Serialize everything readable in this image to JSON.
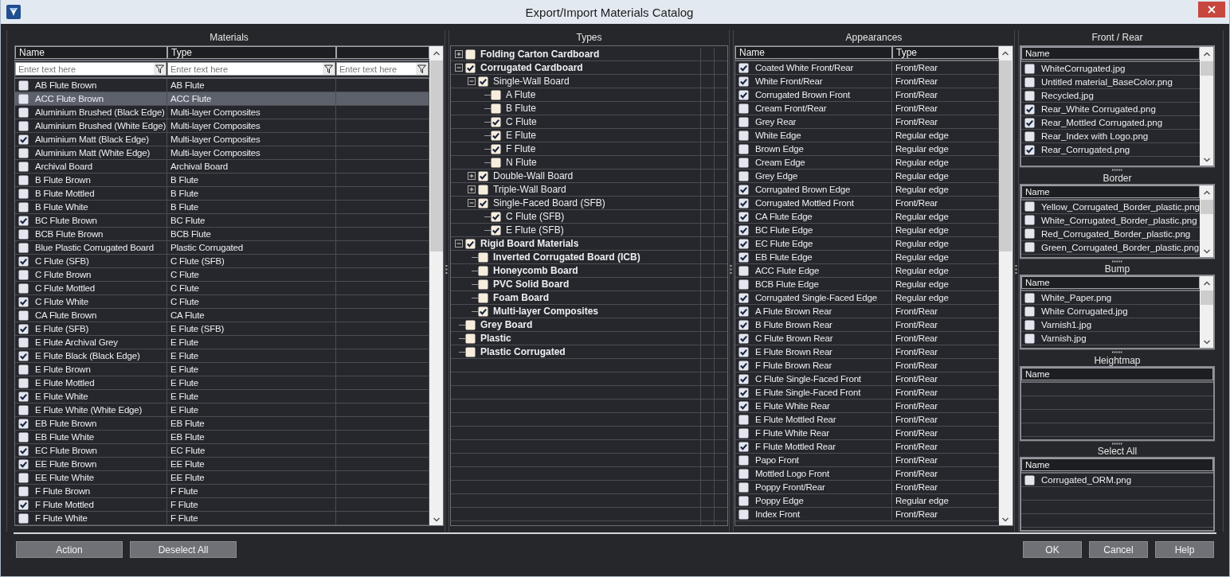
{
  "window": {
    "title": "Export/Import Materials Catalog"
  },
  "materials": {
    "title": "Materials",
    "columns": [
      {
        "label": "Name",
        "placeholder": "Enter text here"
      },
      {
        "label": "Type",
        "placeholder": "Enter text here"
      },
      {
        "placeholder": "Enter text here"
      }
    ],
    "rows": [
      {
        "name": "AB Flute Brown",
        "type": "AB Flute",
        "checked": false,
        "selected": false
      },
      {
        "name": "ACC Flute Brown",
        "type": "ACC Flute",
        "checked": false,
        "selected": true
      },
      {
        "name": "Aluminium Brushed (Black Edge)",
        "type": "Multi-layer Composites",
        "checked": false,
        "selected": false
      },
      {
        "name": "Aluminium Brushed (White Edge)",
        "type": "Multi-layer Composites",
        "checked": false,
        "selected": false
      },
      {
        "name": "Aluminium Matt (Black Edge)",
        "type": "Multi-layer Composites",
        "checked": true,
        "selected": false
      },
      {
        "name": "Aluminium Matt (White Edge)",
        "type": "Multi-layer Composites",
        "checked": false,
        "selected": false
      },
      {
        "name": "Archival Board",
        "type": "Archival Board",
        "checked": false,
        "selected": false
      },
      {
        "name": "B Flute Brown",
        "type": "B Flute",
        "checked": false,
        "selected": false
      },
      {
        "name": "B Flute Mottled",
        "type": "B Flute",
        "checked": false,
        "selected": false
      },
      {
        "name": "B Flute White",
        "type": "B Flute",
        "checked": false,
        "selected": false
      },
      {
        "name": "BC Flute Brown",
        "type": "BC Flute",
        "checked": true,
        "selected": false
      },
      {
        "name": "BCB Flute Brown",
        "type": "BCB Flute",
        "checked": false,
        "selected": false
      },
      {
        "name": "Blue Plastic Corrugated Board",
        "type": "Plastic Corrugated",
        "checked": false,
        "selected": false
      },
      {
        "name": "C Flute (SFB)",
        "type": "C Flute (SFB)",
        "checked": true,
        "selected": false
      },
      {
        "name": "C Flute Brown",
        "type": "C Flute",
        "checked": false,
        "selected": false
      },
      {
        "name": "C Flute Mottled",
        "type": "C Flute",
        "checked": false,
        "selected": false
      },
      {
        "name": "C Flute White",
        "type": "C Flute",
        "checked": true,
        "selected": false
      },
      {
        "name": "CA Flute Brown",
        "type": "CA Flute",
        "checked": false,
        "selected": false
      },
      {
        "name": "E Flute (SFB)",
        "type": "E Flute (SFB)",
        "checked": true,
        "selected": false
      },
      {
        "name": "E Flute Archival Grey",
        "type": "E Flute",
        "checked": false,
        "selected": false
      },
      {
        "name": "E Flute Black (Black Edge)",
        "type": "E Flute",
        "checked": true,
        "selected": false
      },
      {
        "name": "E Flute Brown",
        "type": "E Flute",
        "checked": false,
        "selected": false
      },
      {
        "name": "E Flute Mottled",
        "type": "E Flute",
        "checked": false,
        "selected": false
      },
      {
        "name": "E Flute White",
        "type": "E Flute",
        "checked": true,
        "selected": false
      },
      {
        "name": "E Flute White (White Edge)",
        "type": "E Flute",
        "checked": false,
        "selected": false
      },
      {
        "name": "EB Flute Brown",
        "type": "EB Flute",
        "checked": true,
        "selected": false
      },
      {
        "name": "EB Flute White",
        "type": "EB Flute",
        "checked": false,
        "selected": false
      },
      {
        "name": "EC Flute Brown",
        "type": "EC Flute",
        "checked": true,
        "selected": false
      },
      {
        "name": "EE Flute Brown",
        "type": "EE Flute",
        "checked": true,
        "selected": false
      },
      {
        "name": "EE Flute White",
        "type": "EE Flute",
        "checked": false,
        "selected": false
      },
      {
        "name": "F Flute Brown",
        "type": "F Flute",
        "checked": false,
        "selected": false
      },
      {
        "name": "F Flute Mottled",
        "type": "F Flute",
        "checked": true,
        "selected": false
      },
      {
        "name": "F Flute White",
        "type": "F Flute",
        "checked": false,
        "selected": false
      }
    ]
  },
  "types": {
    "title": "Types",
    "tree": [
      {
        "label": "Folding Carton Cardboard",
        "bold": true,
        "checked": false,
        "expanded": false
      },
      {
        "label": "Corrugated Cardboard",
        "bold": true,
        "checked": true,
        "expanded": true,
        "children": [
          {
            "label": "Single-Wall Board",
            "bold": false,
            "checked": true,
            "expanded": true,
            "children": [
              {
                "label": "A Flute",
                "bold": false,
                "checked": false
              },
              {
                "label": "B Flute",
                "bold": false,
                "checked": false
              },
              {
                "label": "C Flute",
                "bold": false,
                "checked": true
              },
              {
                "label": "E Flute",
                "bold": false,
                "checked": true
              },
              {
                "label": "F Flute",
                "bold": false,
                "checked": true
              },
              {
                "label": "N Flute",
                "bold": false,
                "checked": false
              }
            ]
          },
          {
            "label": "Double-Wall Board",
            "bold": false,
            "checked": true,
            "expanded": false
          },
          {
            "label": "Triple-Wall Board",
            "bold": false,
            "checked": false,
            "expanded": false
          },
          {
            "label": "Single-Faced Board (SFB)",
            "bold": false,
            "checked": true,
            "expanded": true,
            "children": [
              {
                "label": "C Flute (SFB)",
                "bold": false,
                "checked": true
              },
              {
                "label": "E Flute (SFB)",
                "bold": false,
                "checked": true
              }
            ]
          }
        ]
      },
      {
        "label": "Rigid Board Materials",
        "bold": true,
        "checked": true,
        "expanded": true,
        "children": [
          {
            "label": "Inverted Corrugated Board (ICB)",
            "bold": true,
            "checked": false
          },
          {
            "label": "Honeycomb Board",
            "bold": true,
            "checked": false
          },
          {
            "label": "PVC Solid Board",
            "bold": true,
            "checked": false
          },
          {
            "label": "Foam Board",
            "bold": true,
            "checked": false
          },
          {
            "label": "Multi-layer Composites",
            "bold": true,
            "checked": true
          }
        ]
      },
      {
        "label": "Grey Board",
        "bold": true,
        "checked": false
      },
      {
        "label": "Plastic",
        "bold": true,
        "checked": false
      },
      {
        "label": "Plastic Corrugated",
        "bold": true,
        "checked": false
      }
    ]
  },
  "appearances": {
    "title": "Appearances",
    "columns": [
      "Name",
      "Type"
    ],
    "rows": [
      {
        "name": "Coated White Front/Rear",
        "type": "Front/Rear",
        "checked": true
      },
      {
        "name": "White Front/Rear",
        "type": "Front/Rear",
        "checked": true
      },
      {
        "name": "Corrugated Brown Front",
        "type": "Front/Rear",
        "checked": true
      },
      {
        "name": "Cream Front/Rear",
        "type": "Front/Rear",
        "checked": false
      },
      {
        "name": "Grey Rear",
        "type": "Front/Rear",
        "checked": false
      },
      {
        "name": "White Edge",
        "type": "Regular edge",
        "checked": false
      },
      {
        "name": "Brown Edge",
        "type": "Regular edge",
        "checked": false
      },
      {
        "name": "Cream Edge",
        "type": "Regular edge",
        "checked": false
      },
      {
        "name": "Grey Edge",
        "type": "Regular edge",
        "checked": false
      },
      {
        "name": "Corrugated Brown Edge",
        "type": "Regular edge",
        "checked": true
      },
      {
        "name": "Corrugated Mottled Front",
        "type": "Front/Rear",
        "checked": true
      },
      {
        "name": "CA Flute Edge",
        "type": "Regular edge",
        "checked": true
      },
      {
        "name": "BC Flute Edge",
        "type": "Regular edge",
        "checked": true
      },
      {
        "name": "EC Flute Edge",
        "type": "Regular edge",
        "checked": true
      },
      {
        "name": "EB Flute Edge",
        "type": "Regular edge",
        "checked": true
      },
      {
        "name": "ACC Flute Edge",
        "type": "Regular edge",
        "checked": false
      },
      {
        "name": "BCB Flute Edge",
        "type": "Regular edge",
        "checked": false
      },
      {
        "name": "Corrugated Single-Faced Edge",
        "type": "Regular edge",
        "checked": true
      },
      {
        "name": "A Flute Brown Rear",
        "type": "Front/Rear",
        "checked": true
      },
      {
        "name": "B Flute Brown Rear",
        "type": "Front/Rear",
        "checked": true
      },
      {
        "name": "C Flute Brown Rear",
        "type": "Front/Rear",
        "checked": true
      },
      {
        "name": "E Flute Brown Rear",
        "type": "Front/Rear",
        "checked": true
      },
      {
        "name": "F Flute Brown Rear",
        "type": "Front/Rear",
        "checked": true
      },
      {
        "name": "C Flute Single-Faced Front",
        "type": "Front/Rear",
        "checked": true
      },
      {
        "name": "E Flute Single-Faced Front",
        "type": "Front/Rear",
        "checked": true
      },
      {
        "name": "E Flute White Rear",
        "type": "Front/Rear",
        "checked": true
      },
      {
        "name": "E Flute Mottled Rear",
        "type": "Front/Rear",
        "checked": false
      },
      {
        "name": "F Flute White Rear",
        "type": "Front/Rear",
        "checked": false
      },
      {
        "name": "F Flute Mottled Rear",
        "type": "Front/Rear",
        "checked": true
      },
      {
        "name": "Papo Front",
        "type": "Front/Rear",
        "checked": false
      },
      {
        "name": "Mottled Logo Front",
        "type": "Front/Rear",
        "checked": false
      },
      {
        "name": "Poppy Front/Rear",
        "type": "Front/Rear",
        "checked": false
      },
      {
        "name": "Poppy Edge",
        "type": "Regular edge",
        "checked": false
      },
      {
        "name": "Index Front",
        "type": "Front/Rear",
        "checked": false
      }
    ]
  },
  "texture_panels": [
    {
      "title": "Front / Rear",
      "column": "Name",
      "rows": [
        {
          "name": "WhiteCorrugated.jpg",
          "checked": false
        },
        {
          "name": "Untitled material_BaseColor.png",
          "checked": false
        },
        {
          "name": "Recycled.jpg",
          "checked": false
        },
        {
          "name": "Rear_White Corrugated.png",
          "checked": true
        },
        {
          "name": "Rear_Mottled Corrugated.png",
          "checked": true
        },
        {
          "name": "Rear_Index with Logo.png",
          "checked": false
        },
        {
          "name": "Rear_Corrugated.png",
          "checked": true
        }
      ]
    },
    {
      "title": "Border",
      "column": "Name",
      "rows": [
        {
          "name": "Yellow_Corrugated_Border_plastic.png",
          "checked": false
        },
        {
          "name": "White_Corrugated_Border_plastic.png",
          "checked": false
        },
        {
          "name": "Red_Corrugated_Border_plastic.png",
          "checked": false
        },
        {
          "name": "Green_Corrugated_Border_plastic.png",
          "checked": false
        }
      ]
    },
    {
      "title": "Bump",
      "column": "Name",
      "rows": [
        {
          "name": "White_Paper.png",
          "checked": false
        },
        {
          "name": "White Corrugated.jpg",
          "checked": false
        },
        {
          "name": "Varnish1.jpg",
          "checked": false
        },
        {
          "name": "Varnish.jpg",
          "checked": false
        }
      ]
    },
    {
      "title": "Heightmap",
      "column": "Name"
    },
    {
      "title": "Select All",
      "column": "Name",
      "rows": [
        {
          "name": "Corrugated_ORM.png",
          "checked": false
        }
      ]
    }
  ],
  "left_buttons": [
    "Action",
    "Deselect All"
  ],
  "right_buttons": [
    "OK",
    "Cancel",
    "Help"
  ]
}
